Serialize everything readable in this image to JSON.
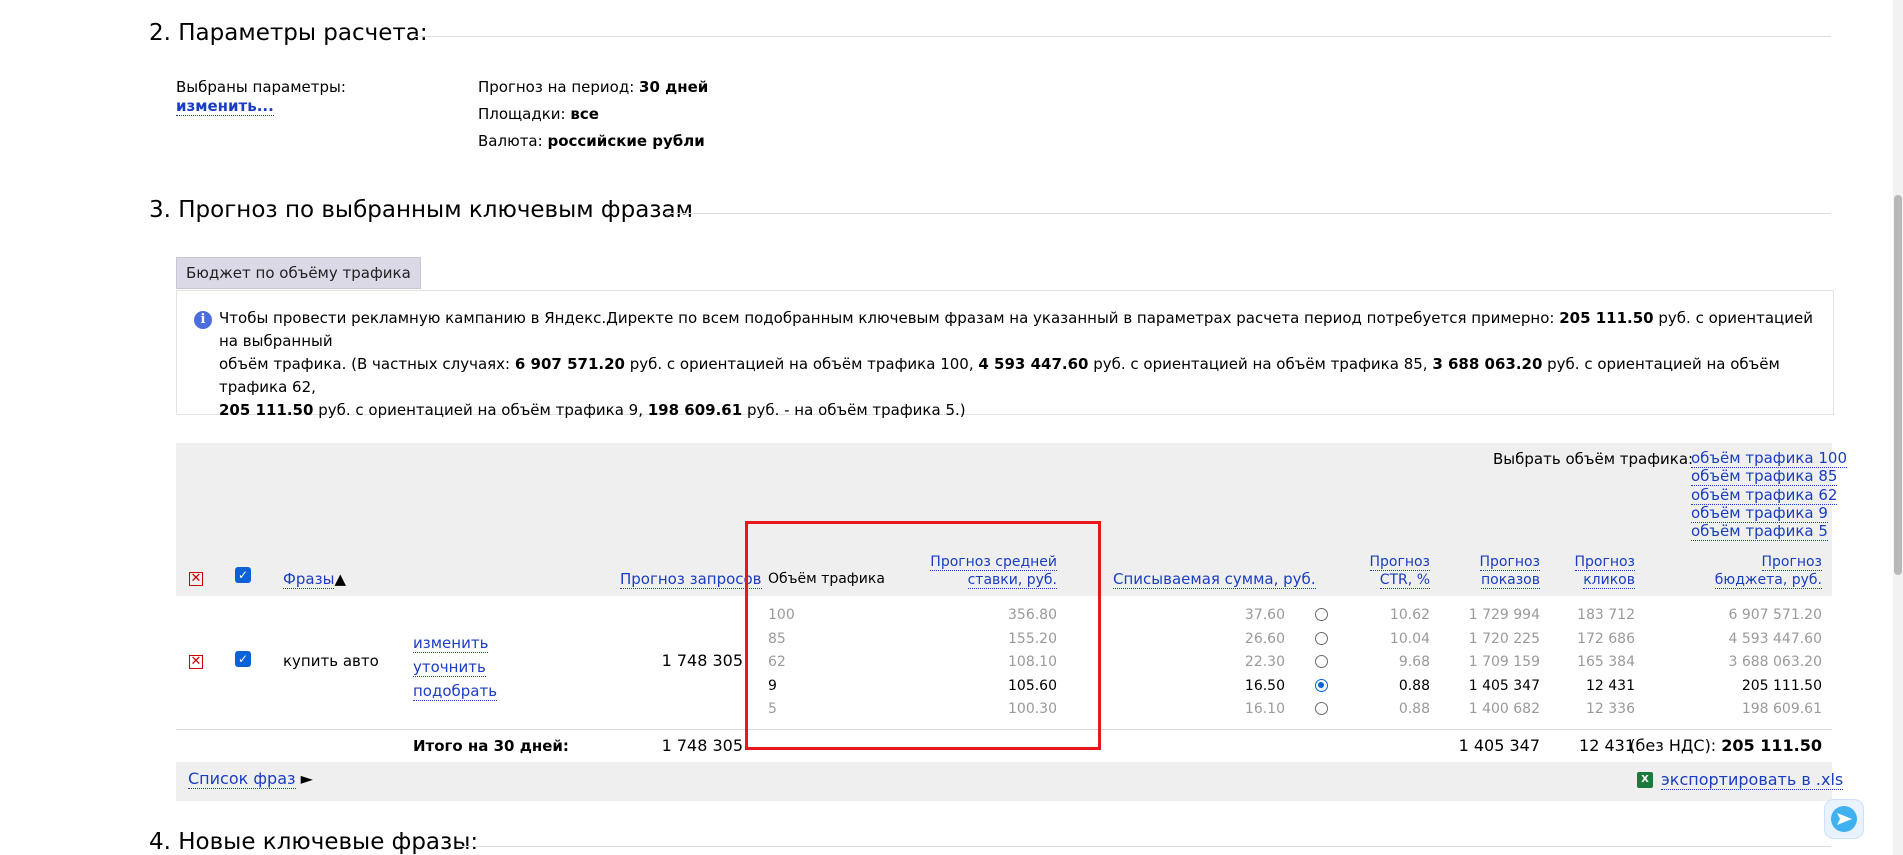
{
  "section2": {
    "title": "2. Параметры расчета:",
    "selected_label": "Выбраны параметры:",
    "change_link": "изменить...",
    "params": [
      {
        "label": "Прогноз на период:",
        "value": "30 дней"
      },
      {
        "label": "Площадки:",
        "value": "все"
      },
      {
        "label": "Валюта:",
        "value": "российские рубли"
      }
    ]
  },
  "section3": {
    "title": "3. Прогноз по выбранным ключевым фразам",
    "tab_label": "Бюджет по объёму трафика",
    "info": {
      "t1": "Чтобы провести рекламную кампанию в Яндекс.Директе по всем подобранным ключевым фразам на указанный в параметрах расчета период потребуется примерно: ",
      "b1": "205 111.50",
      "t2": " руб. с ориентацией на выбранный",
      "t3": "объём трафика. (В частных случаях: ",
      "b2": "6 907 571.20",
      "t4": " руб. с ориентацией на объём трафика 100, ",
      "b3": "4 593 447.60",
      "t5": " руб. с ориентацией на объём трафика 85, ",
      "b4": "3 688 063.20",
      "t6": " руб. с ориентацией на объём трафика 62,",
      "b5": "205 111.50",
      "t7": " руб. с ориентацией на объём трафика 9, ",
      "b6": "198 609.61",
      "t8": " руб. - на объём трафика 5.)"
    },
    "traffic_select": {
      "label": "Выбрать объём трафика:",
      "options": [
        "объём трафика 100",
        "объём трафика 85",
        "объём трафика 62",
        "объём трафика 9",
        "объём трафика 5"
      ]
    },
    "headers": {
      "phrases": "Фразы",
      "sort_arrow": "▲",
      "requests": "Прогноз запросов",
      "traffic": "Объём трафика",
      "bid_line1": "Прогноз средней",
      "bid_line2": "ставки, руб.",
      "charged": "Списываемая сумма, руб.",
      "ctr_line1": "Прогноз",
      "ctr_line2": "CTR, %",
      "shows_line1": "Прогноз",
      "shows_line2": "показов",
      "clicks_line1": "Прогноз",
      "clicks_line2": "кликов",
      "budget_line1": "Прогноз",
      "budget_line2": "бюджета, руб."
    },
    "phrase_row": {
      "phrase": "купить авто",
      "actions": [
        "изменить",
        "уточнить",
        "подобрать"
      ],
      "requests": "1 748 305",
      "levels": [
        {
          "traffic": "100",
          "bid": "356.80",
          "charged": "37.60",
          "ctr": "10.62",
          "shows": "1 729 994",
          "clicks": "183 712",
          "budget": "6 907 571.20",
          "selected": false
        },
        {
          "traffic": "85",
          "bid": "155.20",
          "charged": "26.60",
          "ctr": "10.04",
          "shows": "1 720 225",
          "clicks": "172 686",
          "budget": "4 593 447.60",
          "selected": false
        },
        {
          "traffic": "62",
          "bid": "108.10",
          "charged": "22.30",
          "ctr": "9.68",
          "shows": "1 709 159",
          "clicks": "165 384",
          "budget": "3 688 063.20",
          "selected": false
        },
        {
          "traffic": "9",
          "bid": "105.60",
          "charged": "16.50",
          "ctr": "0.88",
          "shows": "1 405 347",
          "clicks": "12 431",
          "budget": "205 111.50",
          "selected": true
        },
        {
          "traffic": "5",
          "bid": "100.30",
          "charged": "16.10",
          "ctr": "0.88",
          "shows": "1 400 682",
          "clicks": "12 336",
          "budget": "198 609.61",
          "selected": false
        }
      ]
    },
    "total": {
      "label": "Итого на 30 дней:",
      "requests": "1 748 305",
      "shows": "1 405 347",
      "clicks": "12 431",
      "budget_prefix": "(без НДС): ",
      "budget": "205 111.50"
    },
    "phrase_list_link": "Список фраз",
    "phrase_list_arrow": "►",
    "export_link": "экспортировать в .xls",
    "xls_icon_text": "X"
  },
  "section4": {
    "title": "4. Новые ключевые фразы:"
  },
  "colors": {
    "link": "#1a3dc1",
    "highlight_box": "#e8171d",
    "accent": "#0b61d6"
  }
}
